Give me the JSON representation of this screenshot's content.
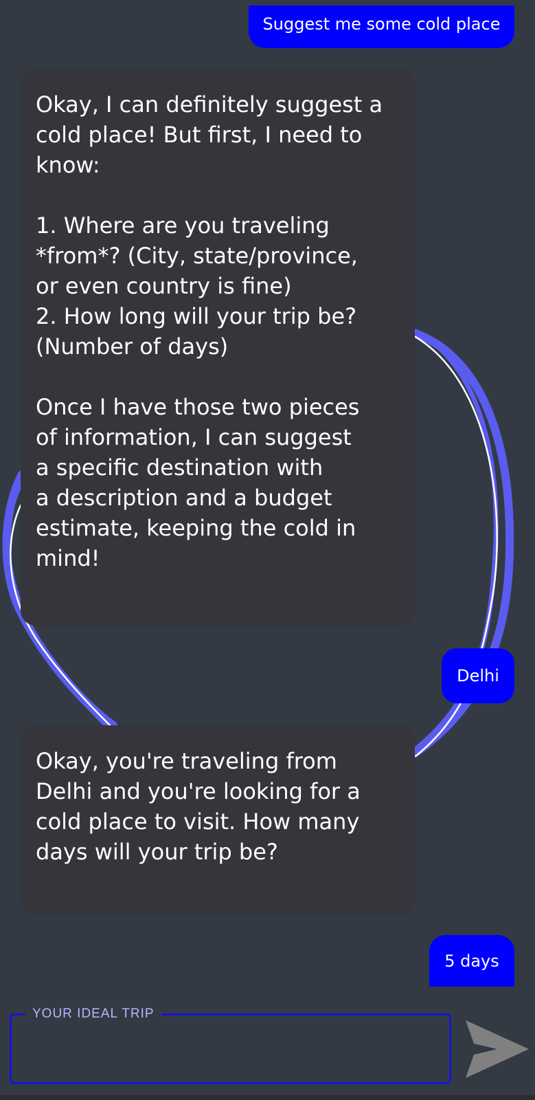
{
  "chat": {
    "messages": [
      {
        "role": "user",
        "text": "Suggest me some cold place"
      },
      {
        "role": "assistant",
        "text": "Okay, I can definitely suggest a\ncold place! But first, I need to\nknow:\n\n1. Where are you traveling\n*from*? (City, state/province,\nor even country is fine)\n2. How long will your trip be?\n(Number of days)\n\nOnce I have those two pieces\nof information, I can suggest\na specific destination with\na description and a budget\nestimate, keeping the cold in\nmind!"
      },
      {
        "role": "user",
        "text": "Delhi"
      },
      {
        "role": "assistant",
        "text": "Okay, you're traveling from\nDelhi and you're looking for a\ncold place to visit. How many\ndays will your trip be?"
      },
      {
        "role": "user",
        "text": "5 days"
      }
    ]
  },
  "input": {
    "label": "YOUR IDEAL TRIP",
    "value": ""
  },
  "send_button": {
    "icon": "send-icon"
  },
  "colors": {
    "background": "#343a43",
    "user_bubble": "#0000ff",
    "assistant_bubble": "#35353b",
    "input_border": "#1515d6",
    "input_label": "#b8b5ff",
    "decoration": "#5a5cf0",
    "send_icon": "#808080"
  }
}
